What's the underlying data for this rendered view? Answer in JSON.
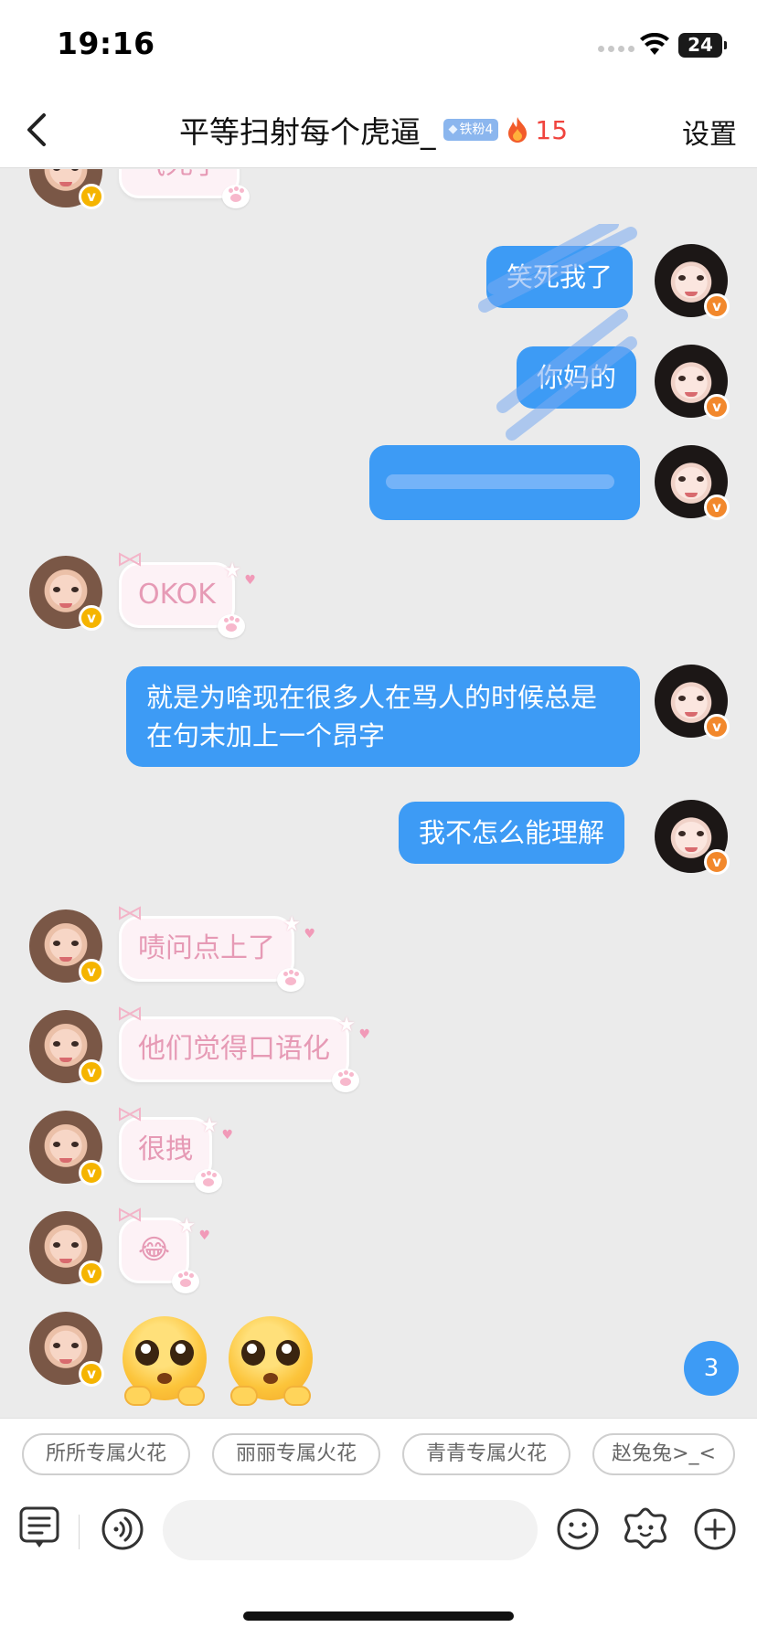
{
  "status_bar": {
    "time": "19:16",
    "battery": "24"
  },
  "header": {
    "title": "平等扫射每个虎逼_",
    "fan_badge": "铁粉4",
    "spark_count": "15",
    "settings_label": "设置"
  },
  "messages": {
    "m0": "气死了",
    "m1": "笑死我了",
    "m2": "你妈的",
    "m3": "",
    "m4": "OKOK",
    "m5": "就是为啥现在很多人在骂人的时候总是在句末加上一个昂字",
    "m6": "我不怎么能理解",
    "m7": "啧问点上了",
    "m8": "他们觉得口语化",
    "m9": "很拽",
    "m10": "😂"
  },
  "unread_count": "3",
  "quick_replies": [
    "所所专属火花",
    "丽丽专属火花",
    "青青专属火花",
    "赵兔兔>_<"
  ],
  "input": {
    "placeholder": ""
  },
  "colors": {
    "my_bubble": "#3d9bf5",
    "their_bubble": "#fdf2f6",
    "their_text": "#e69ab5",
    "spark": "#f0443e"
  },
  "icons": {
    "back": "chevron-left-icon",
    "fire": "fire-icon",
    "verified": "verified-v-icon",
    "notes": "notes-icon",
    "voice": "voice-icon",
    "emoji": "smiley-icon",
    "sticker": "sticker-icon",
    "add": "plus-circle-icon"
  }
}
